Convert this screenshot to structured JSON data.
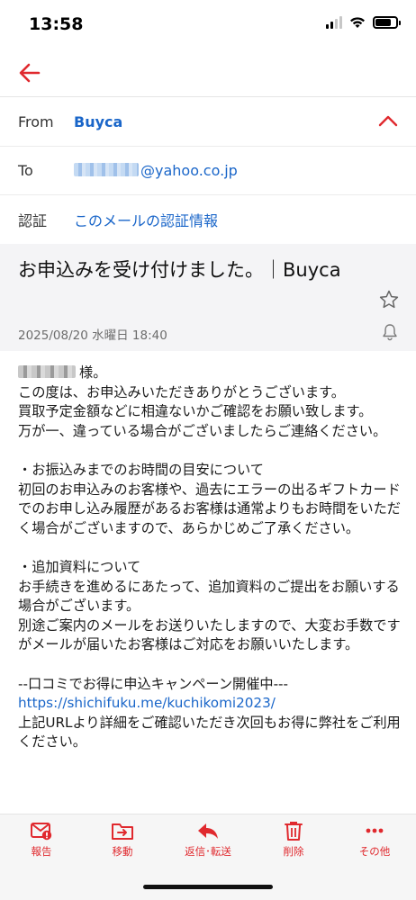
{
  "status_bar": {
    "time": "13:58",
    "signal_bars_active": 2,
    "signal_bars_total": 4,
    "battery_level": 0.75
  },
  "nav": {
    "back_icon": "arrow-left-icon",
    "accent_color": "#e0292e"
  },
  "header": {
    "from_label": "From",
    "from_value": "Buyca",
    "to_label": "To",
    "to_value": "@yahoo.co.jp",
    "auth_label": "認証",
    "auth_value": "このメールの認証情報",
    "link_color": "#1a66c9"
  },
  "subject": {
    "title": "お申込みを受け付けました。｜Buyca",
    "date": "2025/08/20 水曜日 18:40"
  },
  "body": {
    "greeting_suffix": "様。",
    "paragraph1": "この度は、お申込みいただきありがとうございます。\n買取予定金額などに相違ないかご確認をお願い致します。\n万が一、違っている場合がございましたらご連絡ください。\n\n・お振込みまでのお時間の目安について\n初回のお申込みのお客様や、過去にエラーの出るギフトカードでのお申し込み履歴があるお客様は通常よりもお時間をいただく場合がございますので、あらかじめご了承ください。\n\n・追加資料について\nお手続きを進めるにあたって、追加資料のご提出をお願いする場合がございます。\n別途ご案内のメールをお送りいたしますので、大変お手数ですがメールが届いたお客様はご対応をお願いいたします。\n\n--口コミでお得に申込キャンペーン開催中---\n",
    "link": "https://shichifuku.me/kuchikomi2023/",
    "paragraph2": "\n上記URLより詳細をご確認いただき次回もお得に弊社をご利用ください。"
  },
  "toolbar": {
    "report": "報告",
    "move": "移動",
    "reply_forward": "返信･転送",
    "delete": "削除",
    "more": "その他"
  }
}
